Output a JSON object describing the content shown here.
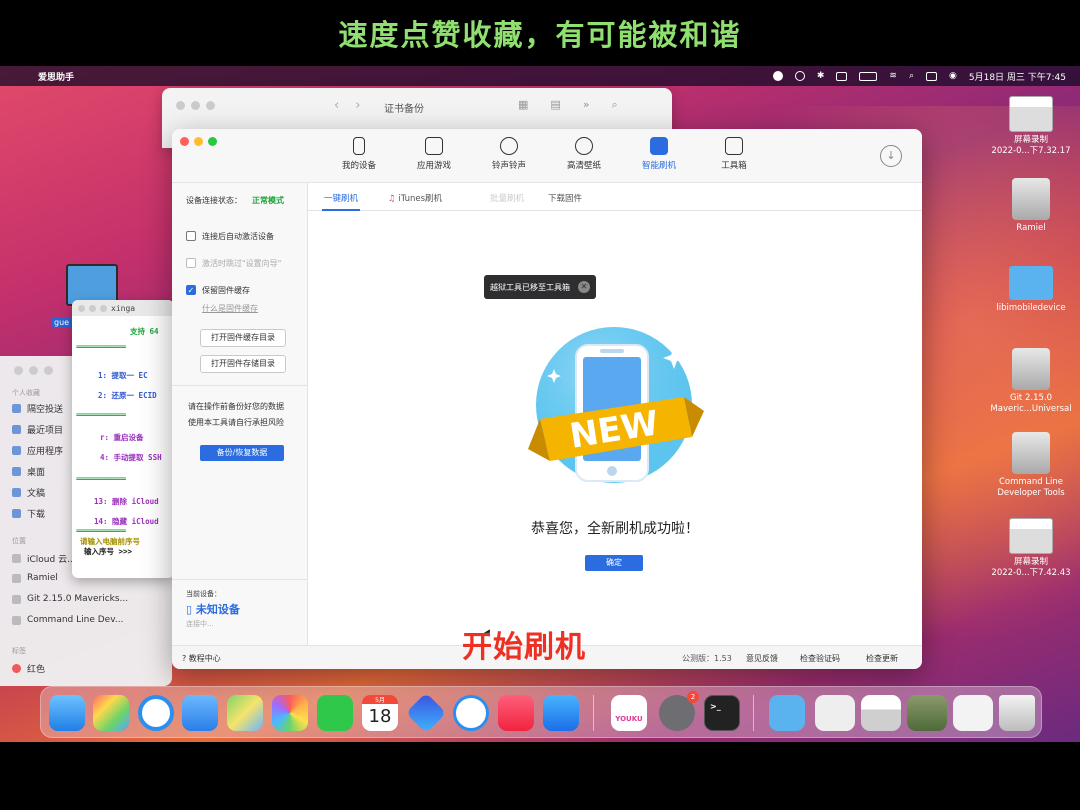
{
  "caption": "速度点赞收藏，有可能被和谐",
  "menubar": {
    "app_name": "爱思助手",
    "datetime": "5月18日 周三 下午7:45"
  },
  "desktop_icons": [
    {
      "label1": "屏幕录制",
      "label2": "2022-0...下7.32.17"
    },
    {
      "label1": "Ramiel",
      "label2": ""
    },
    {
      "label1": "libimobiledevice",
      "label2": ""
    },
    {
      "label1": "Git 2.15.0",
      "label2": "Maveric...Universal"
    },
    {
      "label1": "Command Line",
      "label2": "Developer Tools"
    },
    {
      "label1": "屏幕录制",
      "label2": "2022-0...下7.42.43"
    }
  ],
  "finder_back": {
    "title": "证书备份"
  },
  "finder_side": {
    "section_personal": "个人收藏",
    "items": [
      "隔空投送",
      "最近项目",
      "应用程序",
      "桌面",
      "文稿",
      "下载"
    ],
    "section_locations": "位置",
    "locations": [
      "iCloud 云...",
      "Ramiel",
      "Git 2.15.0 Mavericks...",
      "Command Line Dev..."
    ],
    "section_tags": "标签",
    "tag": "红色"
  },
  "terminal": {
    "title": "xinga",
    "support": "支持 64",
    "dashes": "==============",
    "lines": [
      {
        "text": "1: 提取一 EC",
        "color": "blue"
      },
      {
        "text": "2: 还原一 ECID",
        "color": "blue"
      },
      {
        "text": "r:  重启设备",
        "color": "purple"
      },
      {
        "text": "4: 手动提取 SSH",
        "color": "purple"
      },
      {
        "text": "13: 删除 iCloud",
        "color": "purple"
      },
      {
        "text": "14: 隐藏 iCloud",
        "color": "purple"
      }
    ],
    "prompt_hint": "请输入电脑前序号",
    "prompt": "输入序号 >>>"
  },
  "folder_label": "gue",
  "app": {
    "toolbar": [
      {
        "label": "我的设备",
        "active": false
      },
      {
        "label": "应用游戏",
        "active": false
      },
      {
        "label": "铃声铃声",
        "active": false
      },
      {
        "label": "高清壁纸",
        "active": false
      },
      {
        "label": "智能刷机",
        "active": true
      },
      {
        "label": "工具箱",
        "active": false
      }
    ],
    "left": {
      "status_label": "设备连接状态：",
      "status_value": "正常模式",
      "opt1": "连接后自动激活设备",
      "opt2": "激活时跳过\"设置向导\"",
      "opt3": "保留固件缓存",
      "link": "什么是固件缓存",
      "btn_cache": "打开固件缓存目录",
      "btn_store": "打开固件存储目录",
      "note1": "请在操作前备份好您的数据",
      "note2": "使用本工具请自行承担风险",
      "backup_btn": "备份/恢复数据",
      "current_device_label": "当前设备：",
      "device_name": "未知设备",
      "device_status": "连接中..."
    },
    "tabs": [
      "一键刷机",
      "iTunes刷机",
      "批量刷机",
      "下载固件"
    ],
    "tooltip": "越狱工具已移至工具箱",
    "new_badge": "NEW",
    "success_msg": "恭喜您，全新刷机成功啦！",
    "ok_btn": "确定",
    "status": {
      "help": "教程中心",
      "version": "公测版：1.53",
      "feedback": "意见反馈",
      "check_verify": "检查验证码",
      "check_update": "检查更新"
    }
  },
  "overlay_text": "开始刷机",
  "dock": {
    "calendar_month": "5月",
    "calendar_day": "18",
    "badge_count": "2",
    "youku": "YOUKU"
  }
}
